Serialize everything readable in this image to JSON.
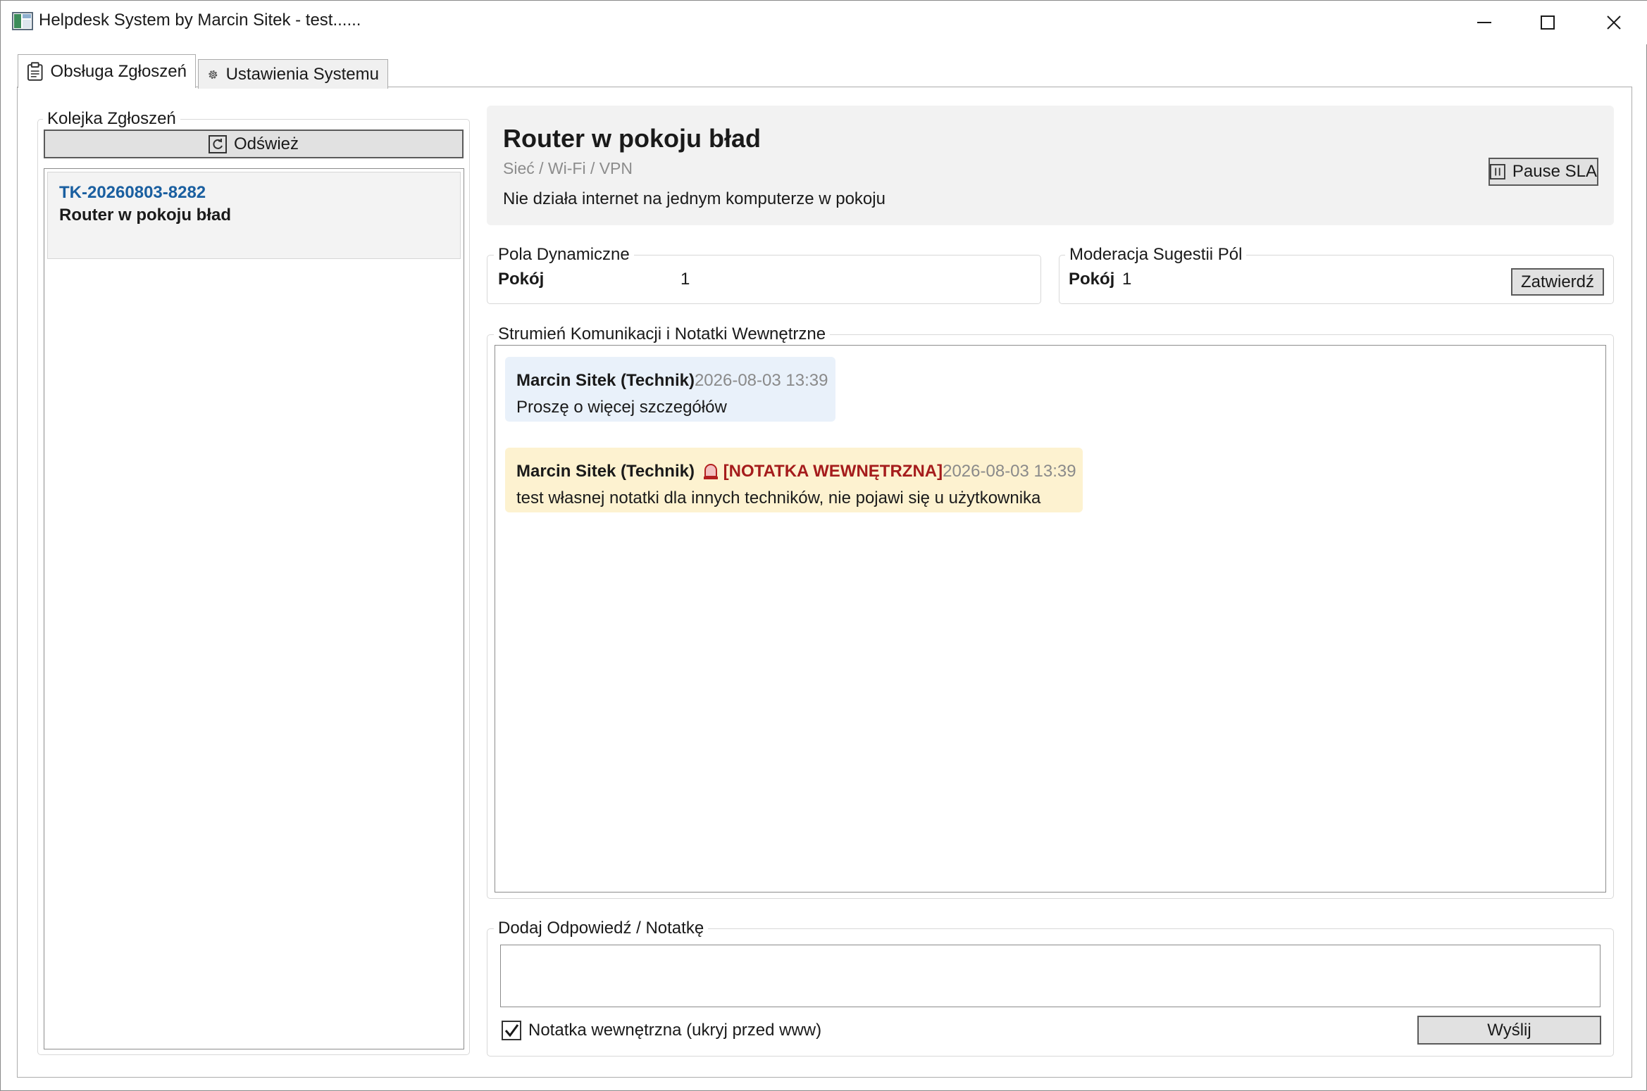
{
  "window": {
    "title": "Helpdesk System by Marcin Sitek - test......",
    "controls": {
      "minimize": "minimize-icon",
      "maximize": "maximize-icon",
      "close": "close-icon"
    }
  },
  "tabs": [
    {
      "label": "Obsługa Zgłoszeń",
      "icon": "clipboard-icon",
      "active": true
    },
    {
      "label": "Ustawienia Systemu",
      "icon": "gear-icon",
      "active": false
    }
  ],
  "queue": {
    "legend": "Kolejka Zgłoszeń",
    "refresh_label": "Odśwież",
    "tickets": [
      {
        "id": "TK-20260803-8282",
        "title": "Router w pokoju bład"
      }
    ]
  },
  "ticket": {
    "title": "Router w pokoju bład",
    "category": "Sieć / Wi-Fi / VPN",
    "description": "Nie działa internet na jednym komputerze w pokoju",
    "pause_sla_label": "Pause SLA"
  },
  "dynamic_fields": {
    "legend": "Pola Dynamiczne",
    "fields": [
      {
        "label": "Pokój",
        "value": "1"
      }
    ]
  },
  "moderation": {
    "legend": "Moderacja Sugestii Pól",
    "fields": [
      {
        "label": "Pokój",
        "value": "1"
      }
    ],
    "approve_label": "Zatwierdź"
  },
  "stream": {
    "legend": "Strumień Komunikacji i Notatki Wewnętrzne",
    "messages": [
      {
        "author": "Marcin Sitek (Technik)",
        "timestamp": "2026-08-03 13:39",
        "body": "Proszę o więcej szczegółów",
        "internal": false,
        "bg": "#e9f1fa"
      },
      {
        "author": "Marcin Sitek (Technik) ",
        "note_tag": "[NOTATKA WEWNĘTRZNA]",
        "timestamp": "2026-08-03 13:39",
        "body": "test własnej notatki dla innych techników, nie pojawi się u użytkownika",
        "internal": true,
        "bg": "#fdf2d0"
      }
    ]
  },
  "reply": {
    "legend": "Dodaj Odpowiedź / Notatkę",
    "text": "",
    "internal_checkbox_label": "Notatka wewnętrzna (ukryj przed www)",
    "internal_checked": true,
    "send_label": "Wyślij"
  },
  "colors": {
    "ticket_id": "#1a5fa0",
    "internal_note": "#a51c1c",
    "public_message_bg": "#e9f1fa",
    "internal_message_bg": "#fdf2d0"
  }
}
